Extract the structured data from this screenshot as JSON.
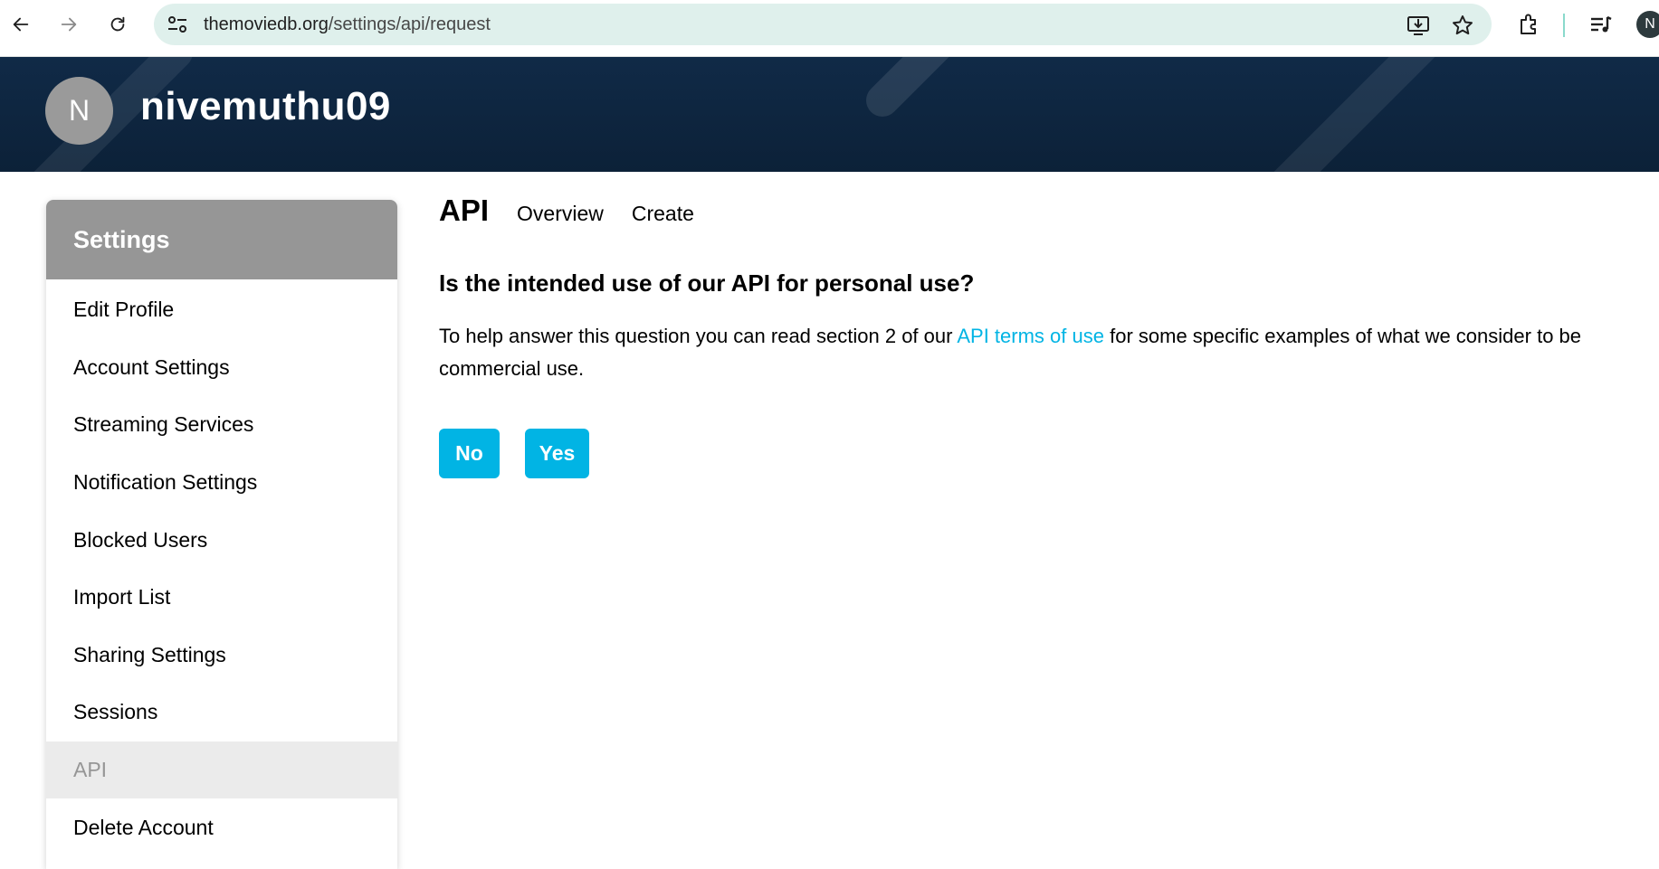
{
  "browser": {
    "url_host": "themoviedb.org",
    "url_path": "/settings/api/request",
    "profile_initial": "N"
  },
  "banner": {
    "avatar_initial": "N",
    "username": "nivemuthu09"
  },
  "sidebar": {
    "title": "Settings",
    "items": [
      {
        "label": "Edit Profile"
      },
      {
        "label": "Account Settings"
      },
      {
        "label": "Streaming Services"
      },
      {
        "label": "Notification Settings"
      },
      {
        "label": "Blocked Users"
      },
      {
        "label": "Import List"
      },
      {
        "label": "Sharing Settings"
      },
      {
        "label": "Sessions"
      },
      {
        "label": "API"
      },
      {
        "label": "Delete Account"
      }
    ],
    "active": "API"
  },
  "main": {
    "title": "API",
    "tabs": [
      "Overview",
      "Create"
    ],
    "question": "Is the intended use of our API for personal use?",
    "desc_before": "To help answer this question you can read section 2 of our ",
    "desc_link": "API terms of use",
    "desc_after": " for some specific examples of what we consider to be commercial use.",
    "no_label": "No",
    "yes_label": "Yes"
  },
  "colors": {
    "banner": "#0f2844",
    "accent": "#01b4e4",
    "sidebar_header": "#969696"
  }
}
